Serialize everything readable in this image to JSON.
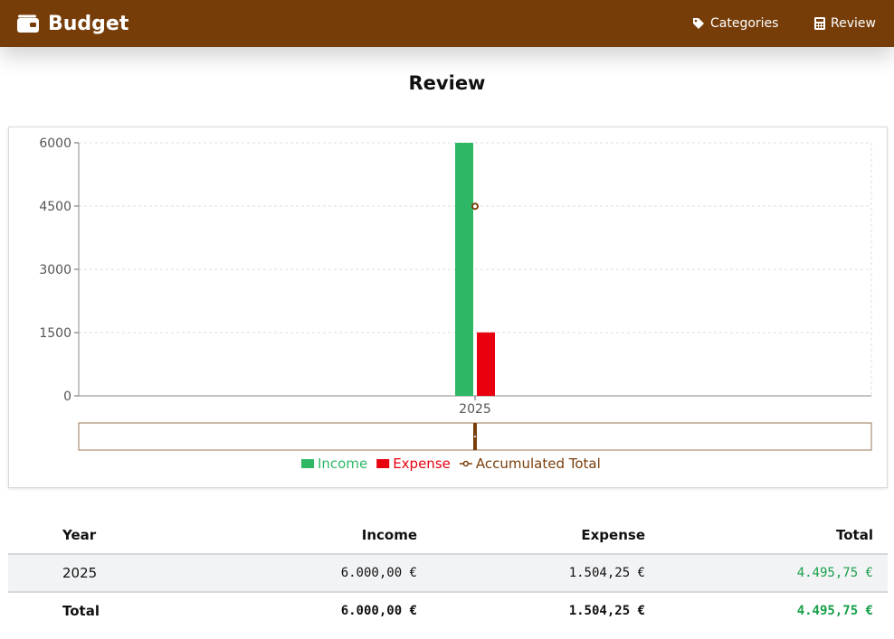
{
  "app": {
    "brand": "Budget",
    "nav": [
      {
        "label": "Categories",
        "icon": "tag-icon"
      },
      {
        "label": "Review",
        "icon": "calculator-icon"
      }
    ]
  },
  "page": {
    "title": "Review"
  },
  "colors": {
    "navbar": "#763d09",
    "income": "#2eb865",
    "expense": "#e8000e",
    "accumulated": "#7a3e0a",
    "positive_text": "#18a04b"
  },
  "chart_data": {
    "type": "bar",
    "categories": [
      "2025"
    ],
    "series": [
      {
        "name": "Income",
        "type": "bar",
        "values": [
          6000
        ]
      },
      {
        "name": "Expense",
        "type": "bar",
        "values": [
          1504.25
        ]
      },
      {
        "name": "Accumulated Total",
        "type": "line",
        "values": [
          4495.75
        ]
      }
    ],
    "yticks": [
      0,
      1500,
      3000,
      4500,
      6000
    ],
    "ylim": [
      0,
      6000
    ],
    "grid": true,
    "legend_position": "bottom",
    "zoom_slider": true
  },
  "table": {
    "headers": {
      "year": "Year",
      "income": "Income",
      "expense": "Expense",
      "total": "Total"
    },
    "rows": [
      {
        "year": "2025",
        "income": "6.000,00 €",
        "expense": "1.504,25 €",
        "total": "4.495,75 €"
      }
    ],
    "footer": {
      "label": "Total",
      "income": "6.000,00 €",
      "expense": "1.504,25 €",
      "total": "4.495,75 €"
    }
  }
}
